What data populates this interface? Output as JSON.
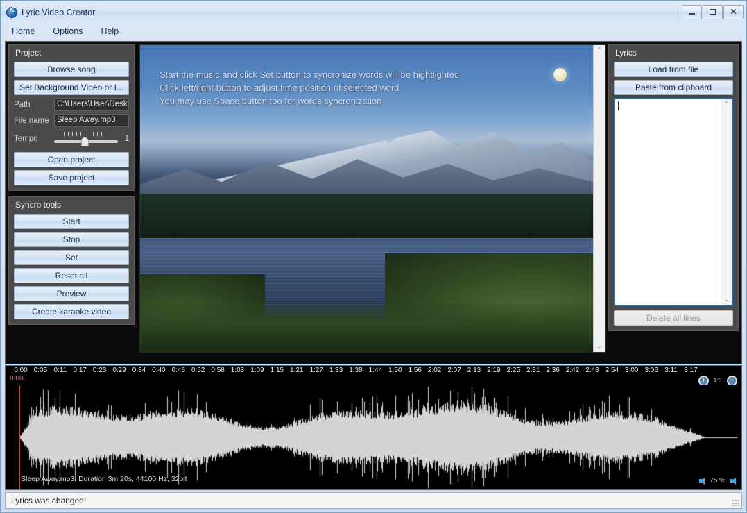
{
  "window": {
    "title": "Lyric Video Creator",
    "app_icon": "app-logo-icon",
    "minimize_label": "",
    "maximize_label": "",
    "close_label": "✕"
  },
  "menubar": {
    "items": [
      {
        "label": "Home"
      },
      {
        "label": "Options"
      },
      {
        "label": "Help"
      }
    ]
  },
  "project_panel": {
    "title": "Project",
    "browse_song_label": "Browse song",
    "set_background_label": "Set  Background  Video  or I...",
    "path_label": "Path",
    "path_value": "C:\\Users\\User\\Desktop",
    "filename_label": "File name",
    "filename_value": "Sleep Away.mp3",
    "tempo_label": "Tempo",
    "tempo_value": "1",
    "open_project_label": "Open project",
    "save_project_label": "Save project"
  },
  "syncro_panel": {
    "title": "Syncro tools",
    "start_label": "Start",
    "stop_label": "Stop",
    "set_label": "Set",
    "reset_all_label": "Reset all",
    "preview_label": "Preview",
    "create_video_label": "Create karaoke video"
  },
  "video_preview": {
    "overlay_lines": [
      "Start the music and click Set button to syncronize words will be hightlighted",
      "Click left/right button to adjust time position of selected word",
      "You may use Space button too for words syncronization"
    ],
    "scroll_up": "⌃",
    "scroll_down": "⌄"
  },
  "lyrics_panel": {
    "title": "Lyrics",
    "load_from_file_label": "Load from file",
    "paste_from_clipboard_label": "Paste from clipboard",
    "lyrics_text": "",
    "delete_all_lines_label": "Delete all lines",
    "delete_all_lines_enabled": false,
    "scroll_up": "⌃",
    "scroll_down": "⌄"
  },
  "timeline": {
    "tick_labels": [
      "0:00",
      "0:05",
      "0:11",
      "0:17",
      "0:23",
      "0:29",
      "0:34",
      "0:40",
      "0:46",
      "0:52",
      "0:58",
      "1:03",
      "1:09",
      "1:15",
      "1:21",
      "1:27",
      "1:33",
      "1:38",
      "1:44",
      "1:50",
      "1:56",
      "2:02",
      "2:07",
      "2:13",
      "2:19",
      "2:25",
      "2:31",
      "2:36",
      "2:42",
      "2:48",
      "2:54",
      "3:00",
      "3:06",
      "3:11",
      "3:17"
    ],
    "playhead_time": "0:00",
    "zoom_in_icon": "zoom-in-icon",
    "zoom_out_icon": "zoom-out-icon",
    "zoom_ratio": "1:1",
    "track_info": "Sleep Away.mp3. Duration 3m 20s, 44100 Hz, 32bit",
    "volume_value": "75 %",
    "volume_down_icon": "speaker-icon",
    "volume_up_icon": "speaker-icon"
  },
  "statusbar": {
    "message": "Lyrics was changed!"
  },
  "colors": {
    "accent": "#2d6ca2",
    "panel_bg": "#4a4a4a",
    "playhead": "#b34a48",
    "waveform": "#d4d4d4"
  }
}
